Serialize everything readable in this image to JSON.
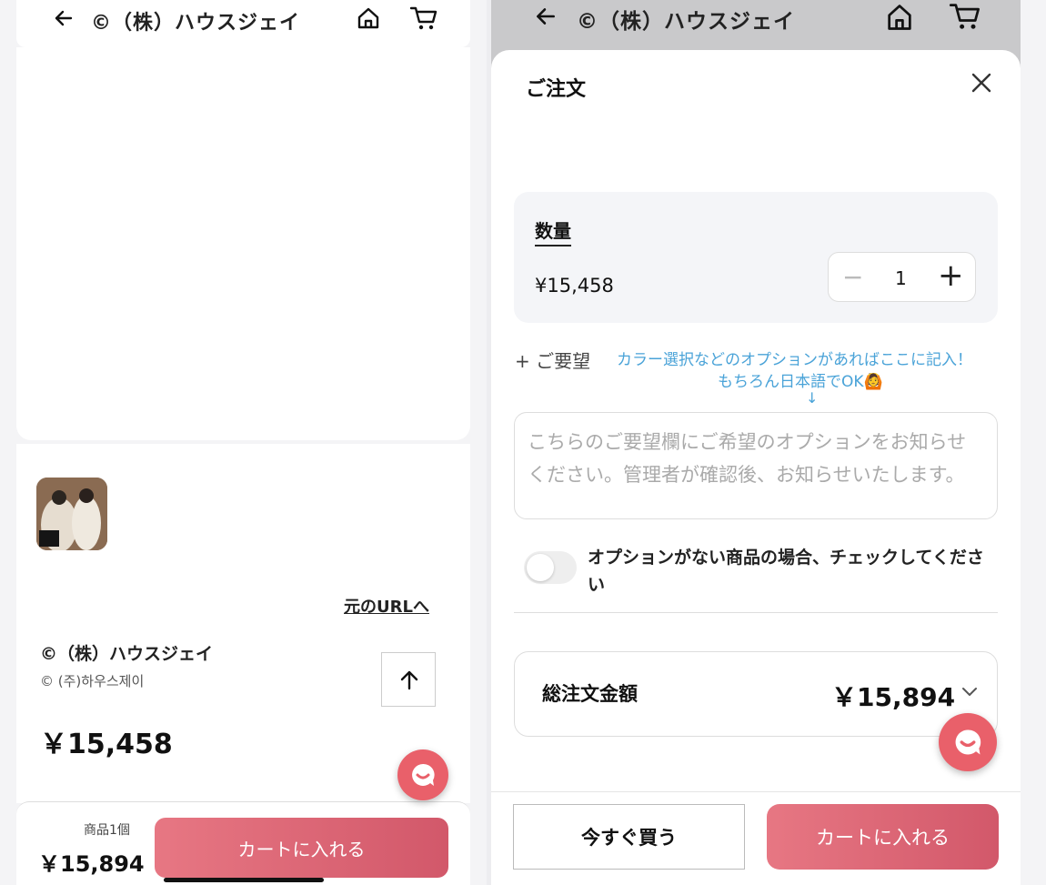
{
  "header": {
    "back_icon": "arrow-left-icon",
    "title": "©（株）ハウスジェイ",
    "home_icon": "home-icon",
    "cart_icon": "cart-icon"
  },
  "product": {
    "original_url_link": "元のURLへ",
    "name": "©（株）ハウスジェイ",
    "name_korean": "© (주)하우스제이",
    "price": "￥15,458",
    "scroll_top_icon": "arrow-up-icon"
  },
  "left_footer": {
    "item_count": "商品1個",
    "total": "￥15,894",
    "add_to_cart": "カートに入れる"
  },
  "order_sheet": {
    "title": "ご注文",
    "close_icon": "close-icon",
    "quantity_label": "数量",
    "unit_price": "¥15,458",
    "quantity_value": "1",
    "minus": "−",
    "plus": "+",
    "request_label": "+ ご要望",
    "hint_line1": "カラー選択などのオプションがあればここに記入！",
    "hint_line2": "もちろん日本語でOK🙆",
    "hint_arrow": "↓",
    "request_placeholder": "こちらのご要望欄にご希望のオプションをお知らせください。管理者が確認後、お知らせいたします。",
    "no_option_toggle_label": "オプションがない商品の場合、チェックしてください",
    "total_label": "総注文金額",
    "total_value": "￥15,894",
    "buy_now": "今すぐ買う",
    "add_to_cart": "カートに入れる"
  },
  "colors": {
    "accent": "#de6472",
    "hint_blue": "#4aa3d8"
  }
}
